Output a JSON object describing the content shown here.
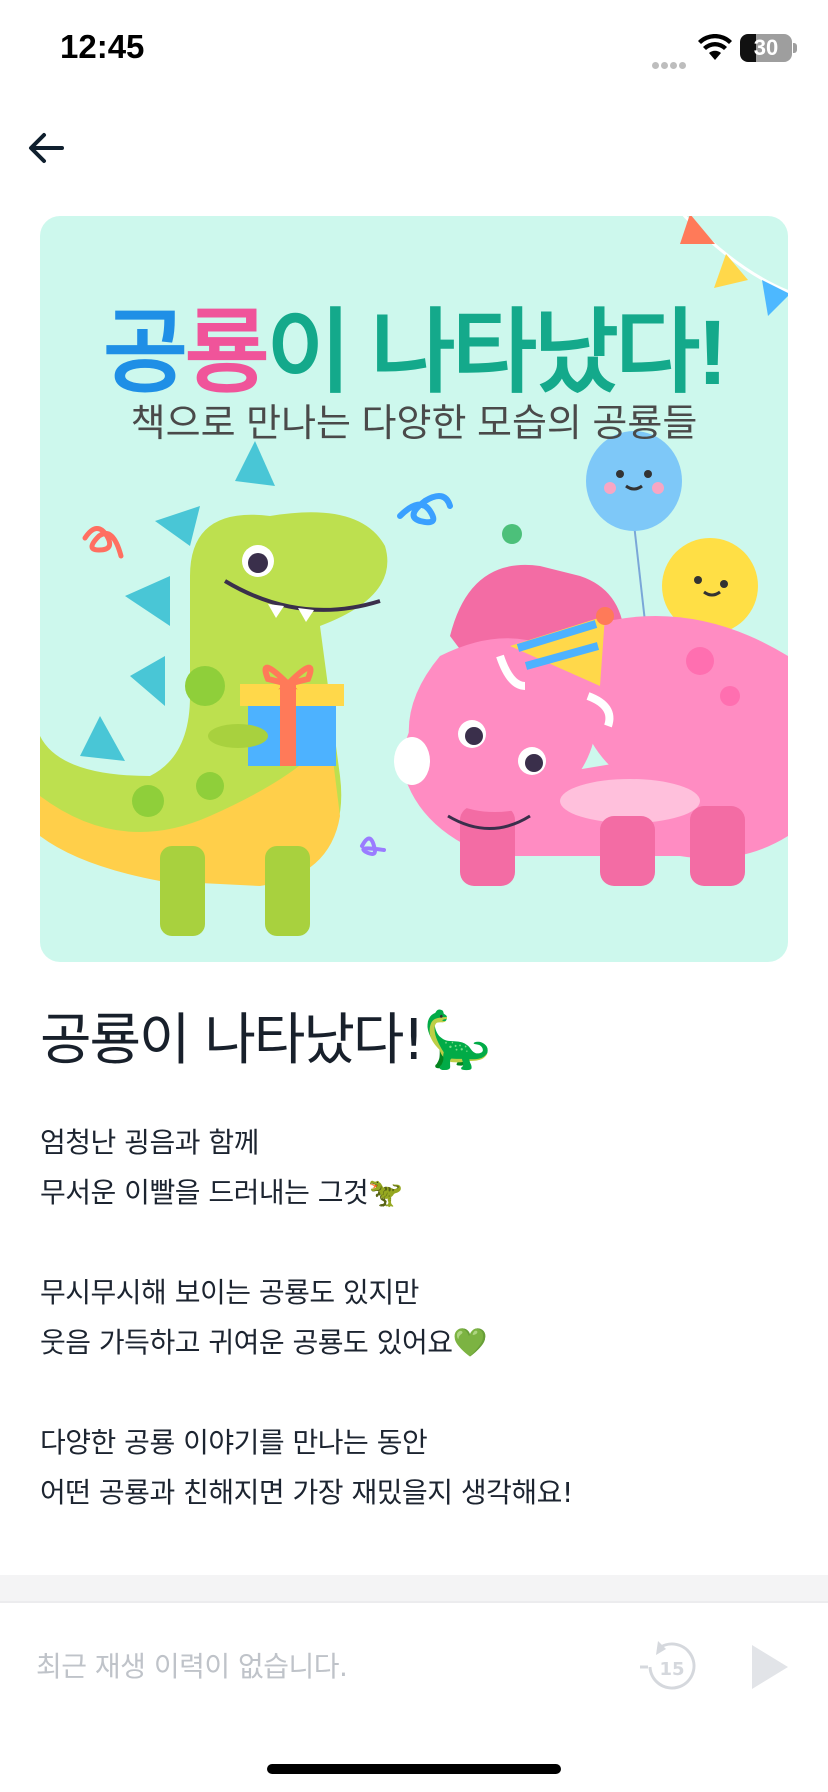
{
  "status_bar": {
    "time": "12:45",
    "battery_level": "30"
  },
  "navigation": {
    "back_icon": "arrow-left-icon"
  },
  "cover": {
    "title_part1": "공",
    "title_part2": "룡",
    "title_part3": "이 나타났다!",
    "subtitle": "책으로 만나는 다양한 모습의 공룡들"
  },
  "content": {
    "title": "공룡이 나타났다!🦕",
    "lines": [
      "엄청난 굉음과 함께",
      "무서운 이빨을 드러내는 그것🦖",
      "",
      "무시무시해 보이는 공룡도 있지만",
      "웃음 가득하고 귀여운 공룡도 있어요💚",
      "",
      "다양한 공룡 이야기를 만나는 동안",
      "어떤 공룡과 친해지면 가장 재밌을지 생각해요!"
    ]
  },
  "player": {
    "status_text": "최근 재생 이력이 없습니다.",
    "rewind_label": "15",
    "rewind_icon": "rewind-15-icon",
    "play_icon": "play-icon"
  },
  "colors": {
    "cover_bg": "#cdf8ed",
    "title_blue": "#1f8fe6",
    "title_pink": "#f0549a",
    "title_green": "#14a98b",
    "disabled_gray": "#d5d8dd"
  }
}
